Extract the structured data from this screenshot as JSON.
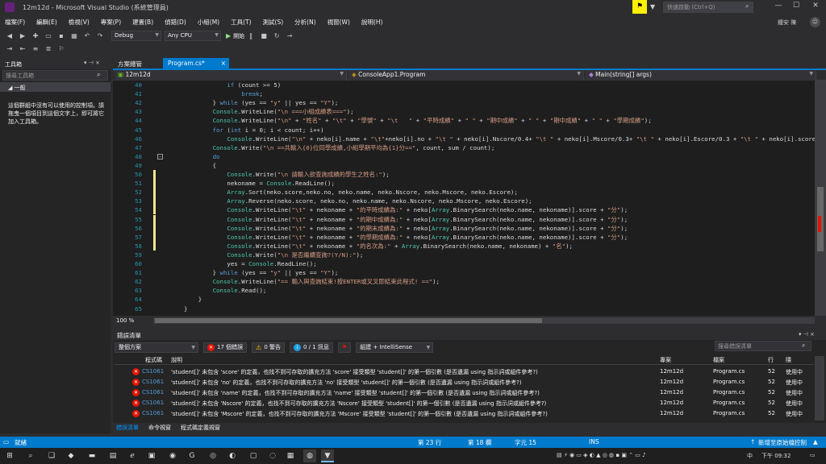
{
  "window": {
    "title": "12m12d - Microsoft Visual Studio (系統管理員)",
    "quick_launch_placeholder": "快速啟動 (Ctrl+Q)",
    "user_name": "鍾安 陳",
    "min_icon": "minimize-icon",
    "max_icon": "maximize-icon",
    "close_icon": "close-icon"
  },
  "menu": [
    "檔案(F)",
    "編輯(E)",
    "檢視(V)",
    "專案(P)",
    "建置(B)",
    "偵錯(D)",
    "小組(M)",
    "工具(T)",
    "測試(S)",
    "分析(N)",
    "視窗(W)",
    "說明(H)"
  ],
  "toolbar": {
    "config": "Debug",
    "platform": "Any CPU",
    "start_label": "開始"
  },
  "toolbox": {
    "title": "工具箱",
    "search_placeholder": "搜尋工具箱",
    "group": "◢ 一般",
    "empty_message": "這個群組中沒有可以使用的控制項。請拖曳一個項目到這個文字上，即可將它加入工具箱。"
  },
  "tabs": {
    "solution_explorer": "方案總管",
    "program": "Program.cs*",
    "close": "×"
  },
  "nav": {
    "project": "12m12d",
    "class": "ConsoleApp1.Program",
    "member": "Main(string[] args)"
  },
  "editor": {
    "zoom": "100 %",
    "lines": [
      {
        "n": "40",
        "t": "            if (count >= 5)",
        "chg": false
      },
      {
        "n": "41",
        "t": "                break;",
        "chg": false
      },
      {
        "n": "42",
        "t": "        } while (yes == \"y\" || yes == \"Y\");",
        "chg": false
      },
      {
        "n": "43",
        "t": "        Console.WriteLine(\"\\n ===小組成績表===\");",
        "chg": false
      },
      {
        "n": "44",
        "t": "        Console.WriteLine(\"\\n\" + \"姓名\" + \"\\t\" + \"學號\" + \"\\t   \" + \"平時成績\" + \" \" + \"期中成績\" + \" \" + \"期中成績\" + \" \" + \"學期成績\");",
        "chg": false
      },
      {
        "n": "45",
        "t": "        for (int i = 0; i < count; i++)",
        "chg": false
      },
      {
        "n": "46",
        "t": "            Console.WriteLine(\"\\n\" + neko[i].name + \"\\t\"+neko[i].no + \"\\t \" + neko[i].Nscore/0.4+ \"\\t \" + neko[i].Mscore/0.3+ \"\\t \" + neko[i].Escore/0.3 + \"\\t \" + neko[i].score + \",\");",
        "chg": false
      },
      {
        "n": "47",
        "t": "        Console.Write(\"\\n ==共輸入{0}位同學成績,小組學期平均為{1}分==\", count, sum / count);",
        "chg": false
      },
      {
        "n": "48",
        "t": "        do",
        "chg": false
      },
      {
        "n": "49",
        "t": "        {",
        "chg": false
      },
      {
        "n": "50",
        "t": "            Console.Write(\"\\n 請輸入欲查詢成績的學生之姓名:\");",
        "chg": true
      },
      {
        "n": "51",
        "t": "            nekoname = Console.ReadLine();",
        "chg": true
      },
      {
        "n": "52",
        "t": "            Array.Sort(neko.score,neko.no, neko.name, neko.Nscore, neko.Mscore, neko.Escore);",
        "chg": true
      },
      {
        "n": "53",
        "t": "            Array.Reverse(neko.score, neko.no, neko.name, neko.Nscore, neko.Mscore, neko.Escore);",
        "chg": true
      },
      {
        "n": "54",
        "t": "            Console.WriteLine(\"\\t\" + nekoname + \"的平時成績為:\" + neko[Array.BinarySearch(neko.name, nekoname)].score + \"分\");",
        "chg": true
      },
      {
        "n": "55",
        "t": "            Console.WriteLine(\"\\t\" + nekoname + \"的期中成績為:\" + neko[Array.BinarySearch(neko.name, nekoname)].score + \"分\");",
        "chg": true
      },
      {
        "n": "56",
        "t": "            Console.WriteLine(\"\\t\" + nekoname + \"的期末成績為:\" + neko[Array.BinarySearch(neko.name, nekoname)].score + \"分\");",
        "chg": true
      },
      {
        "n": "57",
        "t": "            Console.WriteLine(\"\\t\" + nekoname + \"的學期成績為:\" + neko[Array.BinarySearch(neko.name, nekoname)].score + \"分\");",
        "chg": true
      },
      {
        "n": "58",
        "t": "            Console.WriteLine(\"\\t\" + nekoname + \"的名次為:\" + Array.BinarySearch(neko.name, nekoname) + \"名\");",
        "chg": true
      },
      {
        "n": "59",
        "t": "            Console.Write(\"\\n 是否繼續查詢?(Y/N):\");",
        "chg": false
      },
      {
        "n": "60",
        "t": "            yes = Console.ReadLine();",
        "chg": false
      },
      {
        "n": "61",
        "t": "        } while (yes == \"y\" || yes == \"Y\");",
        "chg": false
      },
      {
        "n": "62",
        "t": "        Console.WriteLine(\"== 輸入與查詢結束!按ENTER或叉叉即結束此程式! ==\");",
        "chg": false
      },
      {
        "n": "63",
        "t": "        Console.Read();",
        "chg": false
      },
      {
        "n": "64",
        "t": "    }",
        "chg": false
      },
      {
        "n": "65",
        "t": "}",
        "chg": false
      }
    ]
  },
  "errors": {
    "title": "錯誤清單",
    "scope": "整個方案",
    "errors_count": "17 個錯誤",
    "warnings_count": "0 警告",
    "messages_count": "0 / 1 訊息",
    "build_filter": "組建 + IntelliSense",
    "search_placeholder": "搜尋錯誤清單",
    "columns": {
      "code": "程式碼",
      "desc": "說明",
      "project": "專案",
      "file": "檔案",
      "line": "行",
      "suppress": "隱"
    },
    "rows": [
      {
        "code": "CS1061",
        "desc": "'student[]' 未包含 'score' 的定義，也找不到可存取的擴充方法 'score' 接受類型 'student[]' 的第一個引數 (是否遺漏 using 指示詞或組件參考?)",
        "project": "12m12d",
        "file": "Program.cs",
        "line": "52",
        "state": "使用中"
      },
      {
        "code": "CS1061",
        "desc": "'student[]' 未包含 'no' 的定義，也找不到可存取的擴充方法 'no' 接受類型 'student[]' 的第一個引數 (是否遺漏 using 指示詞或組件參考?)",
        "project": "12m12d",
        "file": "Program.cs",
        "line": "52",
        "state": "使用中"
      },
      {
        "code": "CS1061",
        "desc": "'student[]' 未包含 'name' 的定義，也找不到可存取的擴充方法 'name' 接受類型 'student[]' 的第一個引數 (是否遺漏 using 指示詞或組件參考?)",
        "project": "12m12d",
        "file": "Program.cs",
        "line": "52",
        "state": "使用中"
      },
      {
        "code": "CS1061",
        "desc": "'student[]' 未包含 'Nscore' 的定義，也找不到可存取的擴充方法 'Nscore' 接受類型 'student[]' 的第一個引數 (是否遺漏 using 指示詞或組件參考?)",
        "project": "12m12d",
        "file": "Program.cs",
        "line": "52",
        "state": "使用中"
      },
      {
        "code": "CS1061",
        "desc": "'student[]' 未包含 'Mscore' 的定義，也找不到可存取的擴充方法 'Mscore' 接受類型 'student[]' 的第一個引數 (是否遺漏 using 指示詞或組件參考?)",
        "project": "12m12d",
        "file": "Program.cs",
        "line": "52",
        "state": "使用中"
      }
    ],
    "bottom_tabs": [
      "錯誤清單",
      "命令視窗",
      "程式碼定義視窗"
    ]
  },
  "status": {
    "ready": "就緒",
    "line": "第 23 行",
    "col": "第 18 欄",
    "ch": "字元 15",
    "ins": "INS",
    "source_control": "新增至原始檔控制"
  },
  "taskbar": {
    "time": "下午 09:32",
    "lang": "中"
  },
  "colors": {
    "accent": "#007acc",
    "error": "#e51400",
    "warning": "#ffcc00"
  }
}
